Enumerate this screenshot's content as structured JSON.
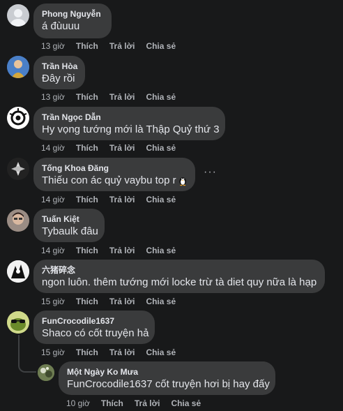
{
  "actions": {
    "like": "Thích",
    "reply": "Trả lời",
    "share": "Chia sẻ"
  },
  "comments": [
    {
      "author": "Phong Nguyễn",
      "text": "á đùuuu",
      "time": "13 giờ"
    },
    {
      "author": "Trần Hòa",
      "text": "Đây rồi",
      "time": "13 giờ"
    },
    {
      "author": "Trần Ngọc Dẫn",
      "text": "Hy vọng tướng mới là Thập Quỷ thứ 3",
      "time": "14 giờ"
    },
    {
      "author": "Tống Khoa Đăng",
      "text": "Thiếu con ác quỷ vaybu top r",
      "time": "14 giờ",
      "more": "···"
    },
    {
      "author": "Tuấn Kiệt",
      "text": "Tybaulk đâu",
      "time": "14 giờ"
    },
    {
      "author": "六猪碎念",
      "text": "ngon luôn. thêm tướng mới locke trừ tà diet quy nữa là hạp",
      "time": "15 giờ"
    },
    {
      "author": "FunCrocodile1637",
      "text": "Shaco có cốt truyện hả",
      "time": "15 giờ"
    },
    {
      "author": "Một Ngày Ko Mưa",
      "text": "FunCrocodile1637 cốt truyện hơi bị hay đấy",
      "time": "10 giờ"
    }
  ],
  "colors": {
    "background": "#18191a",
    "bubble": "#3a3b3c",
    "meta": "#b0b3b8"
  }
}
